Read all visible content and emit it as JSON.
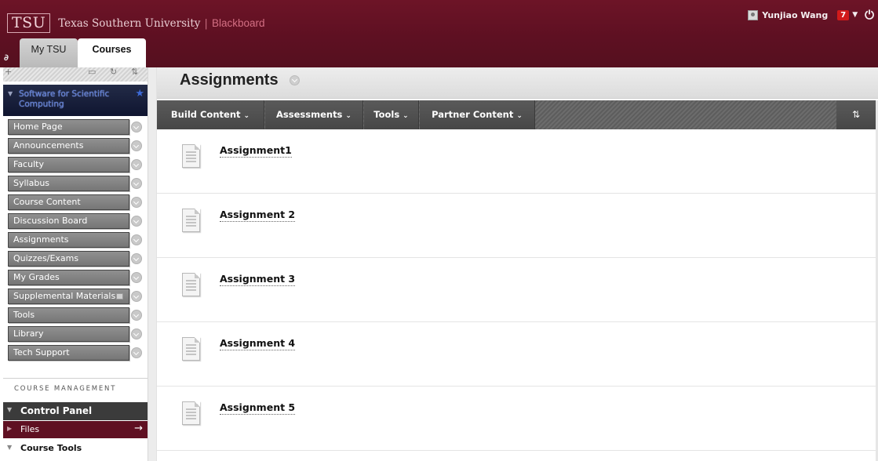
{
  "header": {
    "logo_abbr": "TSU",
    "university_name": "Texas Southern University",
    "separator": "|",
    "platform_name": "Blackboard",
    "user_name": "Yunjiao Wang",
    "notification_count": "7",
    "dropdown_icon": "caret-down-icon",
    "power_icon": "power-icon",
    "tabs": [
      {
        "label": "My TSU"
      },
      {
        "label": "Courses",
        "active": true
      }
    ],
    "colors": {
      "brand": "#5e1022",
      "badge": "#d11a1a"
    }
  },
  "sidebar": {
    "course_title": "Software for Scientific Computing",
    "menu": [
      {
        "label": "Home Page"
      },
      {
        "label": "Announcements"
      },
      {
        "label": "Faculty"
      },
      {
        "label": "Syllabus"
      },
      {
        "label": "Course Content"
      },
      {
        "label": "Discussion Board"
      },
      {
        "label": "Assignments"
      },
      {
        "label": "Quizzes/Exams"
      },
      {
        "label": "My Grades"
      },
      {
        "label": "Supplemental Materials"
      },
      {
        "label": "Tools"
      },
      {
        "label": "Library"
      },
      {
        "label": "Tech Support"
      }
    ],
    "management_label": "COURSE MANAGEMENT",
    "control_panel": "Control Panel",
    "files": "Files",
    "course_tools": "Course Tools"
  },
  "main": {
    "title": "Assignments",
    "actions": [
      {
        "label": "Build Content"
      },
      {
        "label": "Assessments"
      },
      {
        "label": "Tools"
      },
      {
        "label": "Partner Content"
      }
    ],
    "items": [
      {
        "title": "Assignment1"
      },
      {
        "title": "Assignment 2"
      },
      {
        "title": "Assignment 3"
      },
      {
        "title": "Assignment 4"
      },
      {
        "title": "Assignment 5"
      }
    ]
  }
}
